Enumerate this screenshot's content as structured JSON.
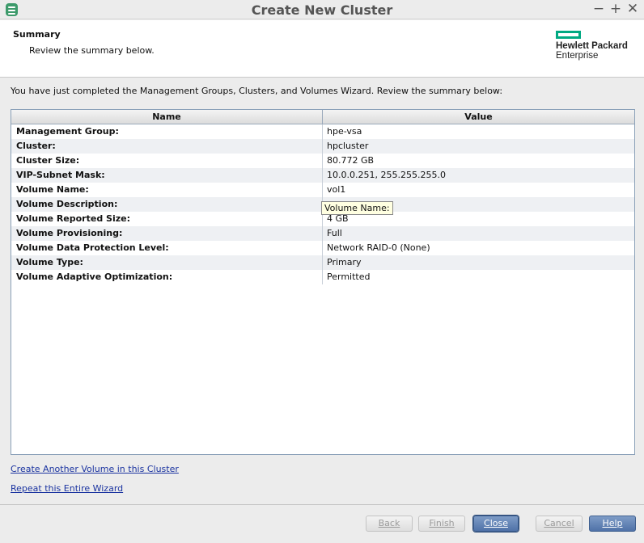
{
  "window": {
    "title": "Create New Cluster",
    "controls": [
      "−",
      "+",
      "✕"
    ]
  },
  "header": {
    "title": "Summary",
    "subtitle": "Review the summary below.",
    "logo": {
      "line1": "Hewlett Packard",
      "line2": "Enterprise",
      "color": "#01a982"
    }
  },
  "intro": "You have just completed the Management Groups, Clusters, and Volumes Wizard. Review the summary below:",
  "table": {
    "columns": [
      "Name",
      "Value"
    ],
    "rows": [
      {
        "name": "Management Group:",
        "value": "hpe-vsa"
      },
      {
        "name": "Cluster:",
        "value": "hpcluster"
      },
      {
        "name": "Cluster Size:",
        "value": "80.772 GB"
      },
      {
        "name": "VIP-Subnet Mask:",
        "value": "10.0.0.251, 255.255.255.0"
      },
      {
        "name": "Volume Name:",
        "value": "vol1"
      },
      {
        "name": "Volume Description:",
        "value": ""
      },
      {
        "name": "Volume Reported Size:",
        "value": "4 GB"
      },
      {
        "name": "Volume Provisioning:",
        "value": "Full"
      },
      {
        "name": "Volume Data Protection Level:",
        "value": "Network RAID-0 (None)"
      },
      {
        "name": "Volume Type:",
        "value": "Primary"
      },
      {
        "name": "Volume Adaptive Optimization:",
        "value": "Permitted"
      }
    ]
  },
  "tooltip": "Volume Name:",
  "links": {
    "create_another": "Create Another Volume in this Cluster",
    "repeat_wizard": "Repeat this Entire Wizard"
  },
  "buttons": {
    "back": "Back",
    "finish": "Finish",
    "close": "Close",
    "cancel": "Cancel",
    "help": "Help"
  }
}
